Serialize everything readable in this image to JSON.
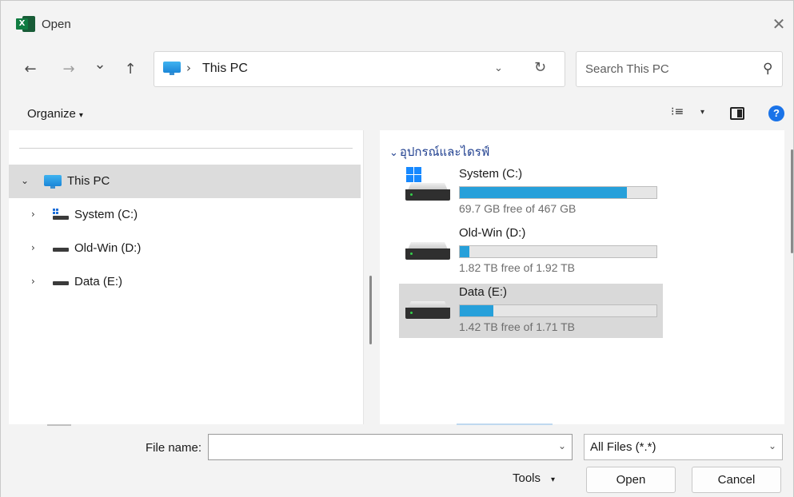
{
  "window": {
    "title": "Open",
    "close_glyph": "✕"
  },
  "nav": {
    "back_glyph": "←",
    "forward_glyph": "→",
    "recent_glyph": "⌄",
    "up_glyph": "↑",
    "address": {
      "separator": "›",
      "path": "This PC",
      "dropdown_glyph": "⌄",
      "refresh_glyph": "↻"
    },
    "search": {
      "placeholder": "Search This PC",
      "icon": "search-icon"
    }
  },
  "toolbar": {
    "organize_label": "Organize",
    "view_glyph": "▯",
    "caret": "▾",
    "help_label": "?"
  },
  "navpane": {
    "items": [
      {
        "label": "This PC",
        "chevron": "⌄",
        "icon": "computer-icon",
        "selected": true
      },
      {
        "label": "System (C:)",
        "chevron": "›",
        "icon": "system-drive-icon"
      },
      {
        "label": "Old-Win (D:)",
        "chevron": "›",
        "icon": "drive-icon"
      },
      {
        "label": "Data (E:)",
        "chevron": "›",
        "icon": "drive-icon"
      }
    ]
  },
  "content": {
    "group_label": "อุปกรณ์และไดรฟ์",
    "group_chevron": "⌄",
    "drives": [
      {
        "name": "System (C:)",
        "free_text": "69.7 GB free of 467 GB",
        "used_fraction": 0.85,
        "windows_logo": true,
        "selected": false
      },
      {
        "name": "Old-Win (D:)",
        "free_text": "1.82 TB free of 1.92 TB",
        "used_fraction": 0.05,
        "windows_logo": false,
        "selected": false
      },
      {
        "name": "Data (E:)",
        "free_text": "1.42 TB free of 1.71 TB",
        "used_fraction": 0.17,
        "windows_logo": false,
        "selected": true
      }
    ]
  },
  "bottom": {
    "file_name_label": "File name:",
    "file_name_value": "",
    "file_type": "All Files (*.*)",
    "tools_label": "Tools",
    "open_label": "Open",
    "cancel_label": "Cancel",
    "dropdown_glyph": "⌄",
    "caret": "▾"
  },
  "colors": {
    "accent": "#26a0da",
    "help": "#1a73e8",
    "group_header": "#1f3f8f",
    "excel_green": "#107c41"
  }
}
